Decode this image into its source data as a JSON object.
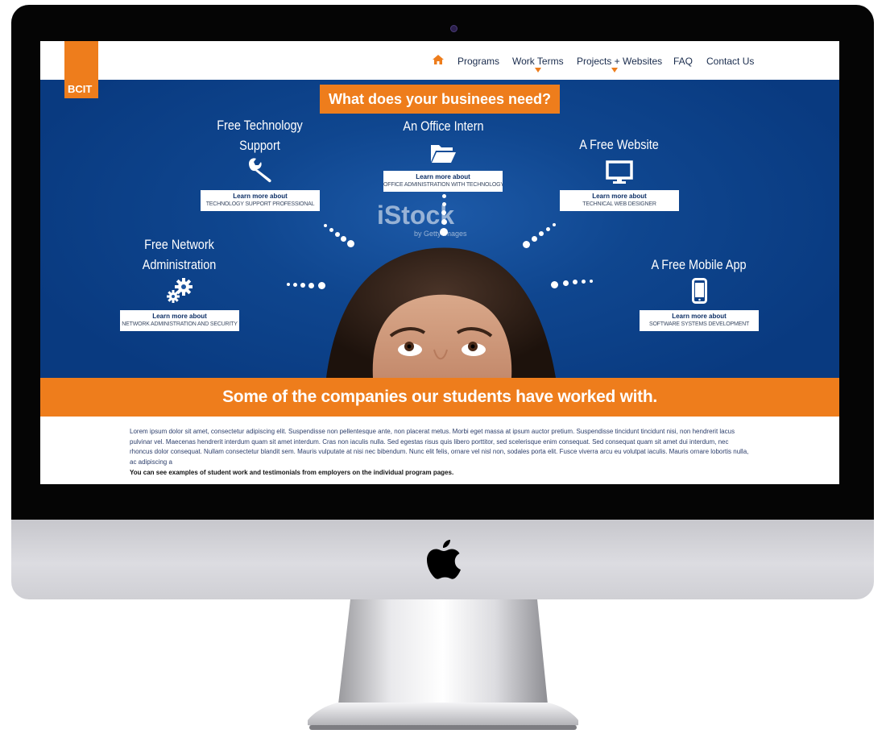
{
  "site": {
    "logo": "BCIT",
    "nav": {
      "home_icon": "home-icon",
      "items": [
        "Programs",
        "Work Terms",
        "Projects + Websites",
        "FAQ",
        "Contact Us"
      ]
    },
    "hero": {
      "banner": "What does your businees need?",
      "watermark": "iStock",
      "watermark_sub": "by Getty Images",
      "services": [
        {
          "title_line1": "Free Technology",
          "title_line2": "Support",
          "cta": "Learn more about",
          "subtitle": "TECHNOLOGY SUPPORT PROFESSIONAL",
          "icon": "wrench-icon"
        },
        {
          "title_line1": "An Office Intern",
          "title_line2": "",
          "cta": "Learn more about",
          "subtitle": "OFFICE ADMINISTRATION WITH TECHNOLOGY",
          "icon": "folder-icon"
        },
        {
          "title_line1": "A Free Website",
          "title_line2": "",
          "cta": "Learn more about",
          "subtitle": "TECHNICAL WEB DESIGNER",
          "icon": "monitor-icon"
        },
        {
          "title_line1": "Free Network",
          "title_line2": "Administration",
          "cta": "Learn more about",
          "subtitle": "NETWORK ADMINISTRATION AND SECURITY",
          "icon": "gears-icon"
        },
        {
          "title_line1": "A Free Mobile App",
          "title_line2": "",
          "cta": "Learn more about",
          "subtitle": "SOFTWARE SYSTEMS DEVELOPMENT",
          "icon": "phone-icon"
        }
      ]
    },
    "companies_heading": "Some of the companies our students have worked with.",
    "body_text": "Lorem ipsum dolor sit amet, consectetur adipiscing elit. Suspendisse non pellentesque ante, non placerat metus. Morbi eget massa at ipsum auctor pretium. Suspendisse tincidunt tincidunt nisi, non hendrerit lacus pulvinar vel. Maecenas hendrerit interdum quam sit amet interdum. Cras non iaculis nulla. Sed egestas risus quis libero porttitor, sed scelerisque enim consequat. Sed consequat quam sit amet dui interdum, nec rhoncus dolor consequat. Nullam consectetur blandit sem. Mauris vulputate at nisi nec bibendum. Nunc elit felis, ornare vel nisl non, sodales porta elit. Fusce viverra arcu eu volutpat iaculis. Mauris ornare lobortis nulla, ac adipiscing a",
    "note": "You can see examples of student work and testimonials from employers on the individual program pages."
  },
  "colors": {
    "accent_orange": "#ee7d1c",
    "hero_blue": "#0f468f",
    "nav_text": "#1a2c4d",
    "bezel": "#050505",
    "chin": "#d3d3d8"
  },
  "device": {
    "camera_icon": "camera-icon",
    "logo_icon": "apple-logo-icon"
  }
}
